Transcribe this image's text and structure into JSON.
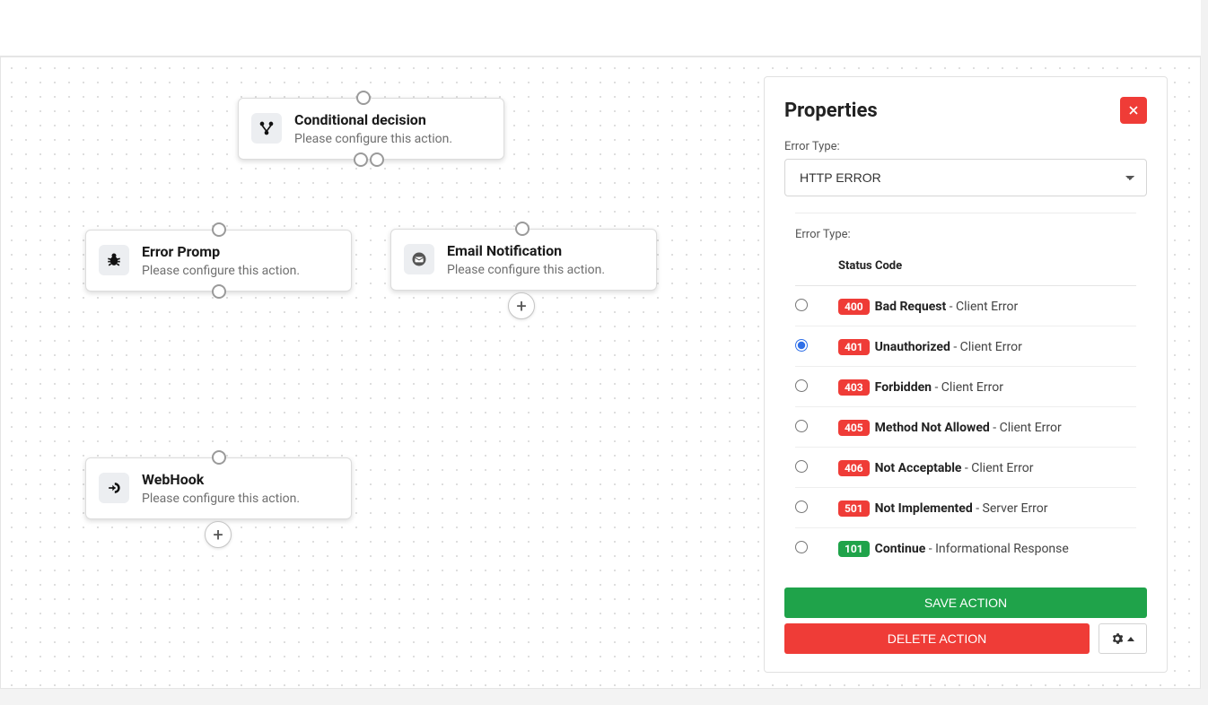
{
  "canvas": {
    "nodes": {
      "conditional": {
        "title": "Conditional decision",
        "subtitle": "Please configure this action."
      },
      "error_prompt": {
        "title": "Error Promp",
        "subtitle": "Please configure this action."
      },
      "email_notification": {
        "title": "Email Notification",
        "subtitle": "Please configure this action."
      },
      "webhook": {
        "title": "WebHook",
        "subtitle": "Please configure this action."
      }
    }
  },
  "panel": {
    "heading": "Properties",
    "error_type_label": "Error Type:",
    "error_type_value": "HTTP ERROR",
    "status_header": "Status Code",
    "selected_code": "401",
    "codes": [
      {
        "code": "400",
        "name": "Bad Request",
        "tail": " - Client Error",
        "color": "red"
      },
      {
        "code": "401",
        "name": "Unauthorized",
        "tail": " - Client Error",
        "color": "red"
      },
      {
        "code": "403",
        "name": "Forbidden",
        "tail": " - Client Error",
        "color": "red"
      },
      {
        "code": "405",
        "name": "Method Not Allowed",
        "tail": " - Client Error",
        "color": "red"
      },
      {
        "code": "406",
        "name": "Not Acceptable",
        "tail": " - Client Error",
        "color": "red"
      },
      {
        "code": "501",
        "name": "Not Implemented",
        "tail": " - Server Error",
        "color": "red"
      },
      {
        "code": "101",
        "name": "Continue",
        "tail": " - Informational Response",
        "color": "green"
      }
    ],
    "save_label": "SAVE ACTION",
    "delete_label": "DELETE ACTION"
  }
}
